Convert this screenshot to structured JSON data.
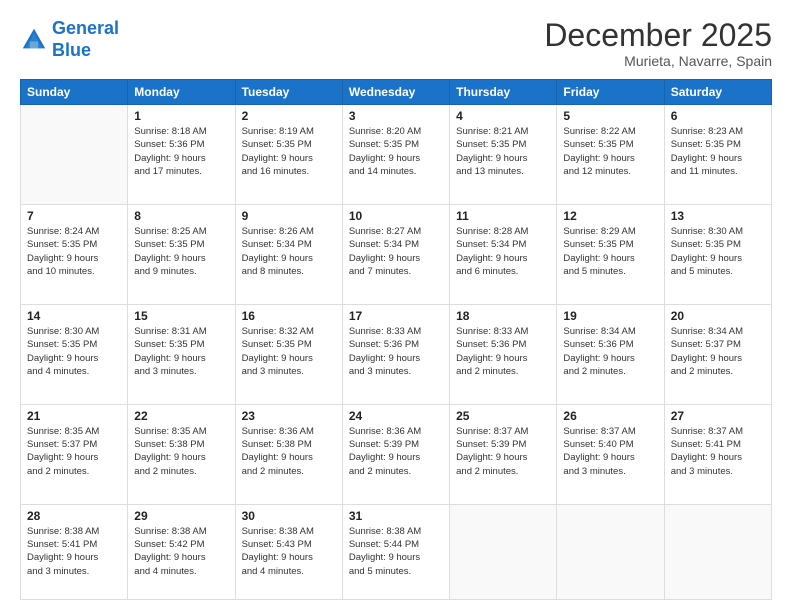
{
  "header": {
    "logo_line1": "General",
    "logo_line2": "Blue",
    "month": "December 2025",
    "location": "Murieta, Navarre, Spain"
  },
  "days_of_week": [
    "Sunday",
    "Monday",
    "Tuesday",
    "Wednesday",
    "Thursday",
    "Friday",
    "Saturday"
  ],
  "weeks": [
    [
      {
        "date": "",
        "info": ""
      },
      {
        "date": "1",
        "info": "Sunrise: 8:18 AM\nSunset: 5:36 PM\nDaylight: 9 hours\nand 17 minutes."
      },
      {
        "date": "2",
        "info": "Sunrise: 8:19 AM\nSunset: 5:35 PM\nDaylight: 9 hours\nand 16 minutes."
      },
      {
        "date": "3",
        "info": "Sunrise: 8:20 AM\nSunset: 5:35 PM\nDaylight: 9 hours\nand 14 minutes."
      },
      {
        "date": "4",
        "info": "Sunrise: 8:21 AM\nSunset: 5:35 PM\nDaylight: 9 hours\nand 13 minutes."
      },
      {
        "date": "5",
        "info": "Sunrise: 8:22 AM\nSunset: 5:35 PM\nDaylight: 9 hours\nand 12 minutes."
      },
      {
        "date": "6",
        "info": "Sunrise: 8:23 AM\nSunset: 5:35 PM\nDaylight: 9 hours\nand 11 minutes."
      }
    ],
    [
      {
        "date": "7",
        "info": "Sunrise: 8:24 AM\nSunset: 5:35 PM\nDaylight: 9 hours\nand 10 minutes."
      },
      {
        "date": "8",
        "info": "Sunrise: 8:25 AM\nSunset: 5:35 PM\nDaylight: 9 hours\nand 9 minutes."
      },
      {
        "date": "9",
        "info": "Sunrise: 8:26 AM\nSunset: 5:34 PM\nDaylight: 9 hours\nand 8 minutes."
      },
      {
        "date": "10",
        "info": "Sunrise: 8:27 AM\nSunset: 5:34 PM\nDaylight: 9 hours\nand 7 minutes."
      },
      {
        "date": "11",
        "info": "Sunrise: 8:28 AM\nSunset: 5:34 PM\nDaylight: 9 hours\nand 6 minutes."
      },
      {
        "date": "12",
        "info": "Sunrise: 8:29 AM\nSunset: 5:35 PM\nDaylight: 9 hours\nand 5 minutes."
      },
      {
        "date": "13",
        "info": "Sunrise: 8:30 AM\nSunset: 5:35 PM\nDaylight: 9 hours\nand 5 minutes."
      }
    ],
    [
      {
        "date": "14",
        "info": "Sunrise: 8:30 AM\nSunset: 5:35 PM\nDaylight: 9 hours\nand 4 minutes."
      },
      {
        "date": "15",
        "info": "Sunrise: 8:31 AM\nSunset: 5:35 PM\nDaylight: 9 hours\nand 3 minutes."
      },
      {
        "date": "16",
        "info": "Sunrise: 8:32 AM\nSunset: 5:35 PM\nDaylight: 9 hours\nand 3 minutes."
      },
      {
        "date": "17",
        "info": "Sunrise: 8:33 AM\nSunset: 5:36 PM\nDaylight: 9 hours\nand 3 minutes."
      },
      {
        "date": "18",
        "info": "Sunrise: 8:33 AM\nSunset: 5:36 PM\nDaylight: 9 hours\nand 2 minutes."
      },
      {
        "date": "19",
        "info": "Sunrise: 8:34 AM\nSunset: 5:36 PM\nDaylight: 9 hours\nand 2 minutes."
      },
      {
        "date": "20",
        "info": "Sunrise: 8:34 AM\nSunset: 5:37 PM\nDaylight: 9 hours\nand 2 minutes."
      }
    ],
    [
      {
        "date": "21",
        "info": "Sunrise: 8:35 AM\nSunset: 5:37 PM\nDaylight: 9 hours\nand 2 minutes."
      },
      {
        "date": "22",
        "info": "Sunrise: 8:35 AM\nSunset: 5:38 PM\nDaylight: 9 hours\nand 2 minutes."
      },
      {
        "date": "23",
        "info": "Sunrise: 8:36 AM\nSunset: 5:38 PM\nDaylight: 9 hours\nand 2 minutes."
      },
      {
        "date": "24",
        "info": "Sunrise: 8:36 AM\nSunset: 5:39 PM\nDaylight: 9 hours\nand 2 minutes."
      },
      {
        "date": "25",
        "info": "Sunrise: 8:37 AM\nSunset: 5:39 PM\nDaylight: 9 hours\nand 2 minutes."
      },
      {
        "date": "26",
        "info": "Sunrise: 8:37 AM\nSunset: 5:40 PM\nDaylight: 9 hours\nand 3 minutes."
      },
      {
        "date": "27",
        "info": "Sunrise: 8:37 AM\nSunset: 5:41 PM\nDaylight: 9 hours\nand 3 minutes."
      }
    ],
    [
      {
        "date": "28",
        "info": "Sunrise: 8:38 AM\nSunset: 5:41 PM\nDaylight: 9 hours\nand 3 minutes."
      },
      {
        "date": "29",
        "info": "Sunrise: 8:38 AM\nSunset: 5:42 PM\nDaylight: 9 hours\nand 4 minutes."
      },
      {
        "date": "30",
        "info": "Sunrise: 8:38 AM\nSunset: 5:43 PM\nDaylight: 9 hours\nand 4 minutes."
      },
      {
        "date": "31",
        "info": "Sunrise: 8:38 AM\nSunset: 5:44 PM\nDaylight: 9 hours\nand 5 minutes."
      },
      {
        "date": "",
        "info": ""
      },
      {
        "date": "",
        "info": ""
      },
      {
        "date": "",
        "info": ""
      }
    ]
  ]
}
